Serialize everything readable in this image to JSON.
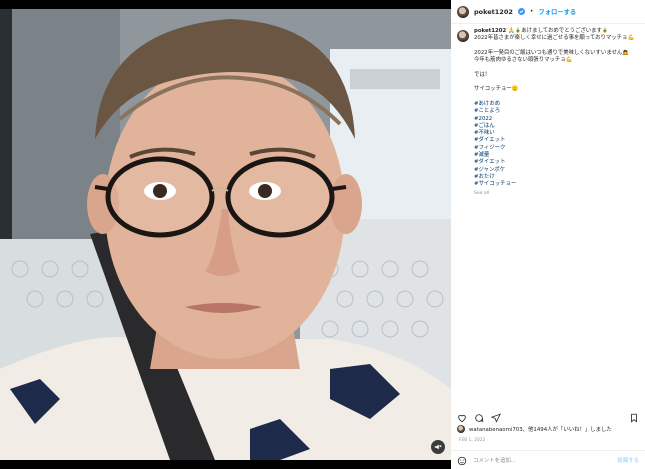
{
  "header": {
    "username": "poket1202",
    "separator": "•",
    "follow_label": "フォローする"
  },
  "caption": {
    "username": "poket1202",
    "lines": [
      "🙏🎍あけましておめでとうございます🎍",
      "2022年皆さまが楽しく幸せに過ごせる事を願っておりマッチョ💪",
      "",
      "2022年一発目のご飯はいつも通りで美味しくないすいません🙇",
      "今年も筋肉ゆるさない頑張りマッチョ💪",
      "",
      "では！",
      "",
      "サイコッチョー🫡"
    ],
    "hashtags": [
      "#あけおめ",
      "#ことよろ",
      "#2022",
      "#ごはん",
      "#不味い",
      "#ダイエット",
      "#フィジーク",
      "#減量",
      "#ダイエット",
      "#ジャンポケ",
      "#おたけ",
      "#サイコッチョー"
    ],
    "see_all": "See all"
  },
  "likes": {
    "text": "watanabenaomi703、他1494人が「いいね！」しました"
  },
  "date": "FEB 1, 2022",
  "comment": {
    "placeholder": "コメントを追加...",
    "post_label": "投稿する"
  }
}
